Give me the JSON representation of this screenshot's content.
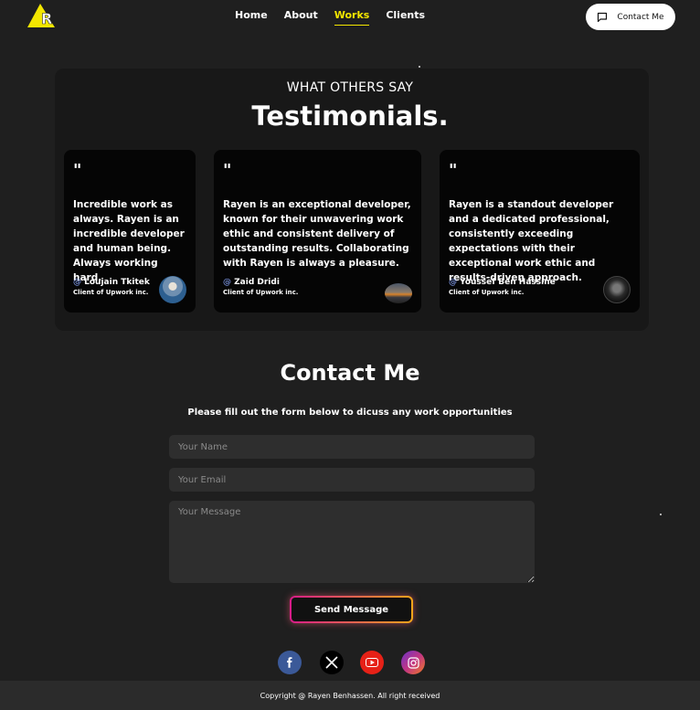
{
  "nav": {
    "items": [
      "Home",
      "About",
      "Works",
      "Clients"
    ],
    "active": "Works",
    "contact_label": "Contact Me"
  },
  "testimonials": {
    "eyebrow": "WHAT OTHERS SAY",
    "title": "Testimonials.",
    "quote_mark": "\"",
    "cards": [
      {
        "text": "Incredible work as always. Rayen is an incredible developer and human being. Always working hard.",
        "at": "@",
        "name": "Loujain Tkitek",
        "role": "Client of Upwork inc.",
        "avatar_icon": "person-avatar"
      },
      {
        "text": "Rayen is an exceptional developer, known for their unwavering work ethic and consistent delivery of outstanding results. Collaborating with Rayen is always a pleasure.",
        "at": "@",
        "name": "Zaid Dridi",
        "role": "Client of Upwork inc.",
        "avatar_icon": "sunset-avatar"
      },
      {
        "text": "Rayen is a standout developer and a dedicated professional, consistently exceeding expectations with their exceptional work ethic and results-driven approach.",
        "at": "@",
        "name": "Youssef Ben Hassine",
        "role": "Client of Upwork inc.",
        "avatar_icon": "dark-avatar"
      }
    ]
  },
  "contact": {
    "title": "Contact Me",
    "subtitle": "Please fill out the form below to dicuss any work opportunities",
    "name_placeholder": "Your Name",
    "email_placeholder": "Your Email",
    "message_placeholder": "Your Message",
    "send_label": "Send Message"
  },
  "socials": [
    {
      "name": "facebook-icon",
      "color": "#3b5998"
    },
    {
      "name": "x-icon",
      "color": "#000000"
    },
    {
      "name": "youtube-icon",
      "color": "#e62117"
    },
    {
      "name": "instagram-icon",
      "color": "#c13584"
    }
  ],
  "footer": {
    "copyright": "Copyright @ Rayen Benhassen. All right received"
  },
  "colors": {
    "accent": "#f3e600",
    "background": "#1f1f1f",
    "card": "#050505"
  }
}
